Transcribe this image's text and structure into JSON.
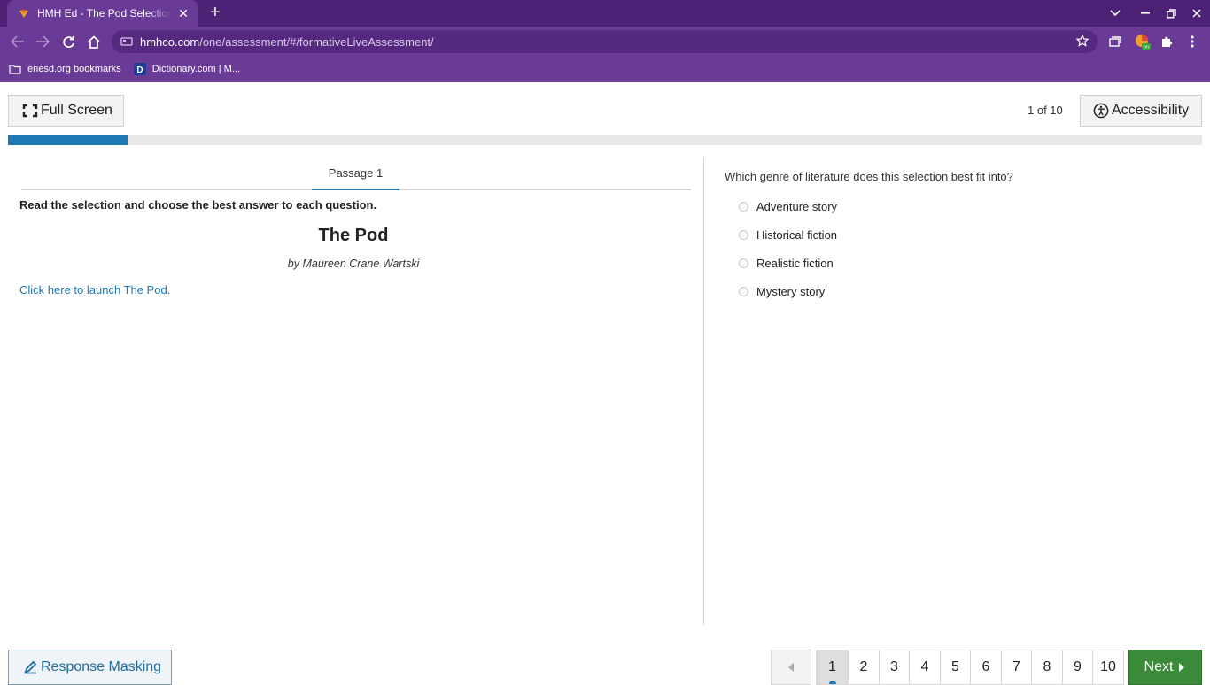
{
  "browser": {
    "tab_title": "HMH Ed - The Pod Selection Test",
    "url_domain": "hmhco.com",
    "url_path": "/one/assessment/#/formativeLiveAssessment/",
    "bookmarks": [
      {
        "label": "eriesd.org bookmarks",
        "icon": "folder-icon"
      },
      {
        "label": "Dictionary.com | M...",
        "icon": "dictionary-favicon"
      }
    ],
    "theme_color": "#6a3a97"
  },
  "header": {
    "fullscreen_label": "Full Screen",
    "question_count": "1 of 10",
    "accessibility_label": "Accessibility",
    "progress_fraction": 0.1
  },
  "passage": {
    "tab_label": "Passage 1",
    "instructions": "Read the selection and choose the best answer to each question.",
    "title": "The Pod",
    "author": "by Maureen Crane Wartski",
    "link_text": "Click here to launch The Pod."
  },
  "question": {
    "text": "Which genre of literature does this selection best fit into?",
    "options": [
      "Adventure story",
      "Historical fiction",
      "Realistic fiction",
      "Mystery story"
    ]
  },
  "footer": {
    "response_masking_label": "Response Masking",
    "pages": [
      "1",
      "2",
      "3",
      "4",
      "5",
      "6",
      "7",
      "8",
      "9",
      "10"
    ],
    "current_page": "1",
    "next_label": "Next"
  },
  "colors": {
    "accent": "#1e78b4",
    "next_button": "#3a8a3a"
  }
}
